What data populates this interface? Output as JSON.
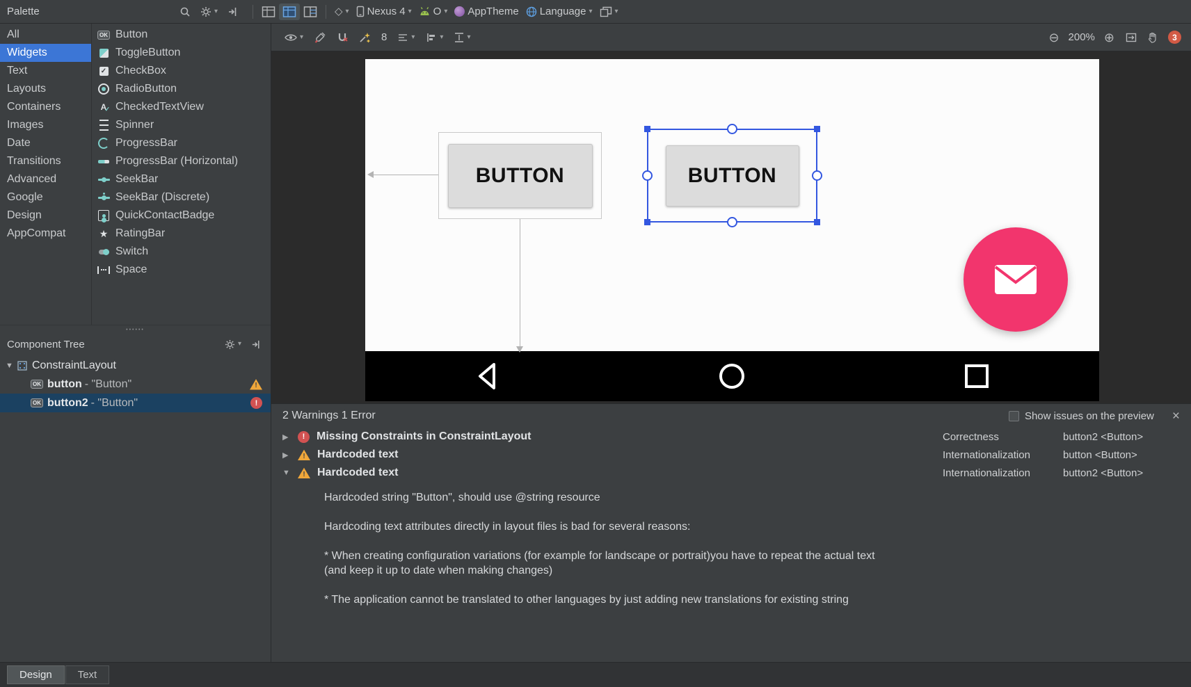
{
  "topbar": {
    "palette_label": "Palette",
    "device_label": "Nexus 4",
    "api_label": "O",
    "theme_label": "AppTheme",
    "language_label": "Language"
  },
  "design_toolbar": {
    "margin_value": "8",
    "zoom_level": "200%",
    "issue_badge": "3"
  },
  "colors": {
    "category_selection_blue": "#3c76d6",
    "canvas_selection_blue": "#3357e0",
    "fab_pink": "#f2356d",
    "warning_yellow": "#f0a73a",
    "error_red": "#d25252"
  },
  "palette": {
    "categories": [
      {
        "label": "All",
        "selected": false
      },
      {
        "label": "Widgets",
        "selected": true
      },
      {
        "label": "Text",
        "selected": false
      },
      {
        "label": "Layouts",
        "selected": false
      },
      {
        "label": "Containers",
        "selected": false
      },
      {
        "label": "Images",
        "selected": false
      },
      {
        "label": "Date",
        "selected": false
      },
      {
        "label": "Transitions",
        "selected": false
      },
      {
        "label": "Advanced",
        "selected": false
      },
      {
        "label": "Google",
        "selected": false
      },
      {
        "label": "Design",
        "selected": false
      },
      {
        "label": "AppCompat",
        "selected": false
      }
    ],
    "widgets": [
      {
        "label": "Button",
        "icon": "button-icon"
      },
      {
        "label": "ToggleButton",
        "icon": "togglebutton-icon"
      },
      {
        "label": "CheckBox",
        "icon": "checkbox-icon"
      },
      {
        "label": "RadioButton",
        "icon": "radiobutton-icon"
      },
      {
        "label": "CheckedTextView",
        "icon": "checkedtextview-icon"
      },
      {
        "label": "Spinner",
        "icon": "spinner-icon"
      },
      {
        "label": "ProgressBar",
        "icon": "progressbar-icon"
      },
      {
        "label": "ProgressBar (Horizontal)",
        "icon": "progressbar-horizontal-icon"
      },
      {
        "label": "SeekBar",
        "icon": "seekbar-icon"
      },
      {
        "label": "SeekBar (Discrete)",
        "icon": "seekbar-discrete-icon"
      },
      {
        "label": "QuickContactBadge",
        "icon": "quickcontactbadge-icon"
      },
      {
        "label": "RatingBar",
        "icon": "ratingbar-icon"
      },
      {
        "label": "Switch",
        "icon": "switch-icon"
      },
      {
        "label": "Space",
        "icon": "space-icon"
      }
    ]
  },
  "component_tree": {
    "title": "Component Tree",
    "root_label": "ConstraintLayout",
    "items": [
      {
        "name": "button",
        "suffix": " - \"Button\"",
        "severity": "warning",
        "selected": false
      },
      {
        "name": "button2",
        "suffix": " - \"Button\"",
        "severity": "error",
        "selected": true
      }
    ]
  },
  "canvas": {
    "button1_label": "BUTTON",
    "button2_label": "BUTTON"
  },
  "issues": {
    "header": "2 Warnings 1 Error",
    "show_on_preview_label": "Show issues on the preview",
    "rows": [
      {
        "expanded": false,
        "severity": "error",
        "title": "Missing Constraints in ConstraintLayout",
        "category": "Correctness",
        "component": "button2 <Button>"
      },
      {
        "expanded": false,
        "severity": "warning",
        "title": "Hardcoded text",
        "category": "Internationalization",
        "component": "button <Button>"
      },
      {
        "expanded": true,
        "severity": "warning",
        "title": "Hardcoded text",
        "category": "Internationalization",
        "component": "button2 <Button>"
      }
    ],
    "detail_paragraphs": [
      "Hardcoded string \"Button\", should use @string resource",
      "Hardcoding text attributes directly in layout files is bad for several reasons:",
      "* When creating configuration variations (for example for landscape or portrait)you have to repeat the actual text\n(and keep it up to date when making changes)",
      "* The application cannot be translated to other languages by just adding new translations for existing string"
    ]
  },
  "bottom_tabs": [
    {
      "label": "Design",
      "active": true
    },
    {
      "label": "Text",
      "active": false
    }
  ]
}
